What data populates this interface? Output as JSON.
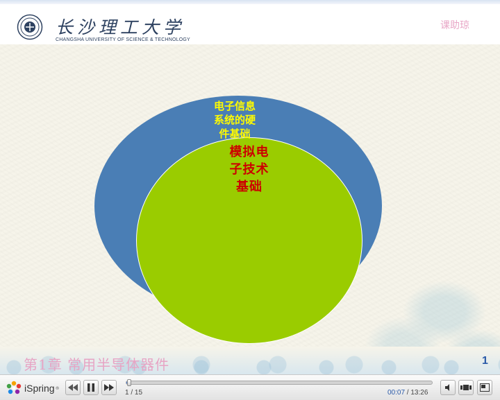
{
  "header": {
    "university_cn": "长沙理工大学",
    "university_en": "CHANGSHA UNIVERSITY OF SCIENCE & TECHNOLOGY",
    "course_badge": "课助琼"
  },
  "diagram": {
    "outer_label_lines": [
      "电子信息",
      "系统的硬",
      "件基础"
    ],
    "inner_label_lines": [
      "模拟电",
      "子技术",
      "基础"
    ],
    "outer_color": "#4a7eb5",
    "inner_color": "#9acc00",
    "outer_text_color": "#fffb00",
    "inner_text_color": "#cc0000"
  },
  "footer": {
    "chapter_title": "第1章   常用半导体器件",
    "slide_number": "1"
  },
  "player": {
    "brand": "iSpring",
    "brand_mark": "®",
    "slide_counter": "1 / 15",
    "current_time": "00:07",
    "time_separator": " / ",
    "total_time": "13:26",
    "progress_fraction": 0.009,
    "buttons": {
      "previous": "previous-icon",
      "pause": "pause-icon",
      "next": "next-icon",
      "volume": "speaker-icon",
      "layout": "layout-icon",
      "fullscreen": "fullscreen-icon"
    }
  }
}
